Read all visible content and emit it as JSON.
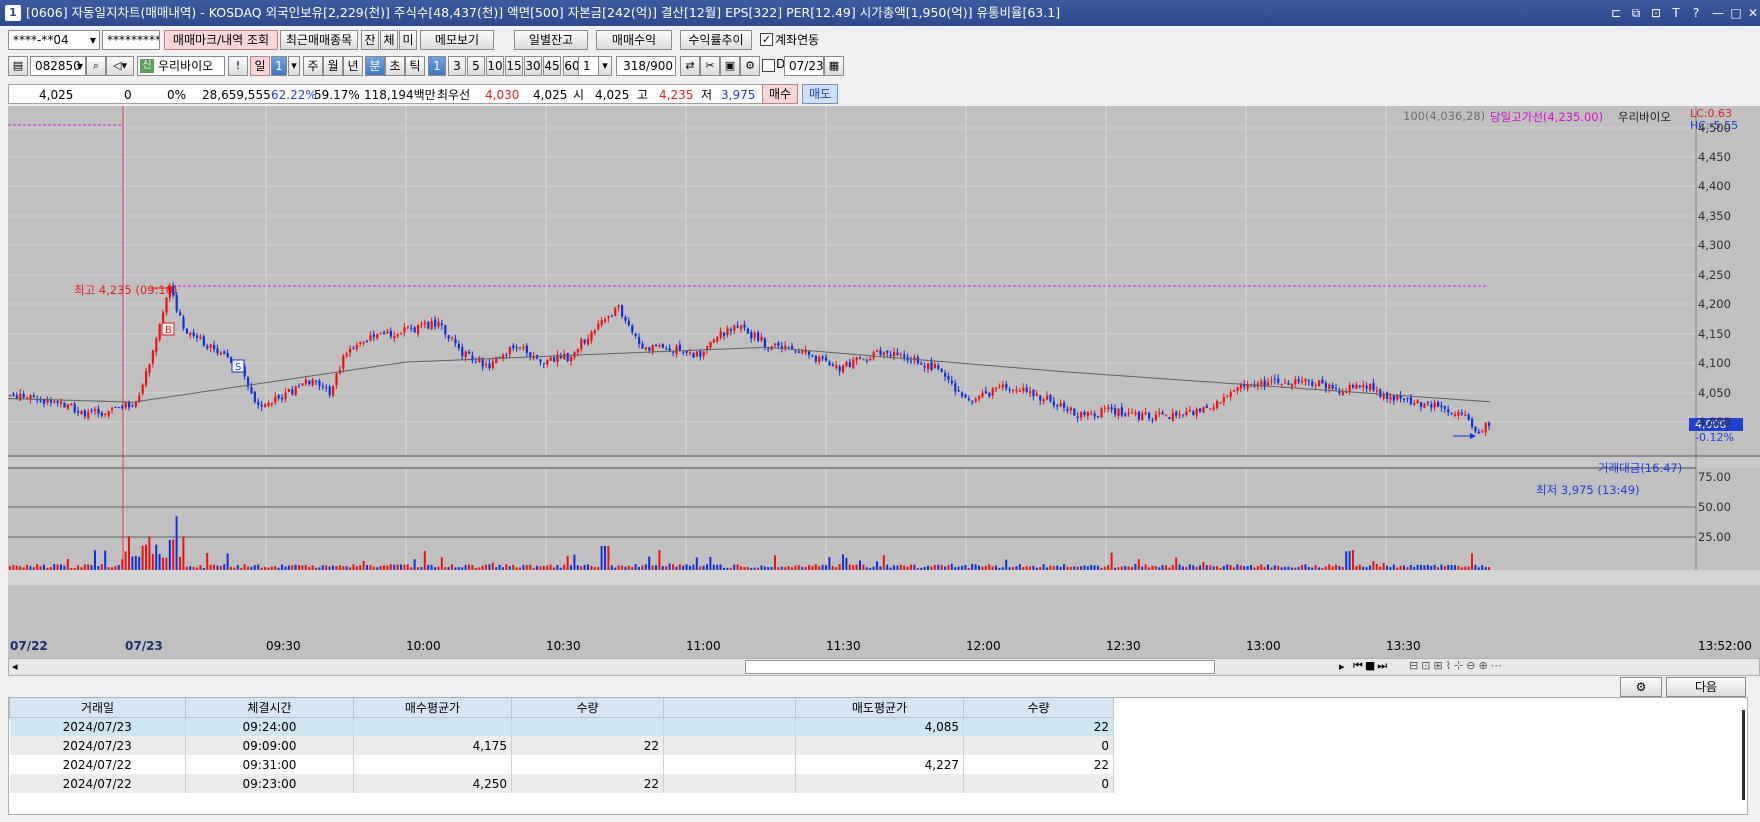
{
  "window": {
    "title": "[0606] 자동일지차트(매매내역) - KOSDAQ 외국인보유[2,229(천)] 주식수[48,437(천)] 액면[500] 자본금[242(억)] 결산[12월] EPS[322] PER[12.49] 시가총액[1,950(억)] 유통비율[63.1]",
    "number": "1"
  },
  "toolbar1": {
    "account": "****-**04",
    "password": "*********",
    "btn_mark": "매매마크/내역 조회",
    "btn_recent": "최근매매종목",
    "btn_jan": "잔",
    "btn_che": "체",
    "btn_mi": "미",
    "btn_memo": "메모보기",
    "btn_daily": "일별잔고",
    "btn_profit": "매매수익",
    "btn_rate": "수익률추이",
    "chk_link": "계좌연동"
  },
  "toolbar2": {
    "code": "082850",
    "stock_name": "우리바이오",
    "periods": [
      "일",
      "1",
      "주",
      "월",
      "년",
      "분",
      "초",
      "틱"
    ],
    "intervals": [
      "1",
      "3",
      "5",
      "10",
      "15",
      "30",
      "45",
      "60"
    ],
    "interval_sel": "1",
    "count": "318",
    "count_total": "/900",
    "date": "07/23",
    "chk_d": "D"
  },
  "quote": {
    "price": "4,025",
    "change": "0",
    "rate": "0%",
    "volume": "28,659,555",
    "v1": "62.22%",
    "v2": "59.17%",
    "amount": "118,194백만",
    "best_label": "최우선",
    "best_ask": "4,030",
    "best_bid": "4,025",
    "open_label": "시",
    "open": "4,025",
    "high_label": "고",
    "high": "4,235",
    "low_label": "저",
    "low": "3,975",
    "buy": "매수",
    "sell": "매도"
  },
  "chart": {
    "legend_ma": "100(4,036,28)",
    "legend_high": "당일고가선(4,235.00)",
    "legend_name": "우리바이오",
    "lc": "LC:0.63",
    "hc": "HC:-5.55",
    "max_label": "최고 4,235 (09:10)",
    "min_label": "최저 3,975 (13:49)",
    "cur_price": "4,000",
    "cur_rate": "-0.12%",
    "vol_legend": "거래대금(16.47)",
    "y_ticks": [
      "4,500",
      "4,450",
      "4,400",
      "4,350",
      "4,300",
      "4,250",
      "4,200",
      "4,150",
      "4,100",
      "4,050",
      "4,000"
    ],
    "vol_ticks": [
      "75.00",
      "50.00",
      "25.00"
    ],
    "x_ticks": [
      "07/22",
      "07/23",
      "09:30",
      "10:00",
      "10:30",
      "11:00",
      "11:30",
      "12:00",
      "12:30",
      "13:00",
      "13:30",
      "13:52:00"
    ],
    "markers": {
      "buy": "B",
      "sell": "S"
    },
    "colors": {
      "up": "#f01010",
      "down": "#1030e0",
      "ma": "#606060",
      "high_line": "#e020e0"
    }
  },
  "chart_data": {
    "type": "candlestick",
    "ylim": [
      3950,
      4520
    ],
    "prev_day_high": 4235,
    "high": {
      "price": 4235,
      "time": "09:10"
    },
    "low": {
      "price": 3975,
      "time": "13:49"
    },
    "last": 4000,
    "change_pct": -0.12
  },
  "bottom": {
    "next": "다음"
  },
  "table": {
    "headers": [
      "거래일",
      "체결시간",
      "매수평균가",
      "수량",
      "",
      "매도평균가",
      "수량"
    ],
    "rows": [
      [
        "2024/07/23",
        "09:24:00",
        "",
        "",
        "",
        "4,085",
        "22"
      ],
      [
        "2024/07/23",
        "09:09:00",
        "4,175",
        "22",
        "",
        "",
        "0"
      ],
      [
        "2024/07/22",
        "09:31:00",
        "",
        "",
        "",
        "4,227",
        "22"
      ],
      [
        "2024/07/22",
        "09:23:00",
        "4,250",
        "22",
        "",
        "",
        "0"
      ]
    ]
  }
}
